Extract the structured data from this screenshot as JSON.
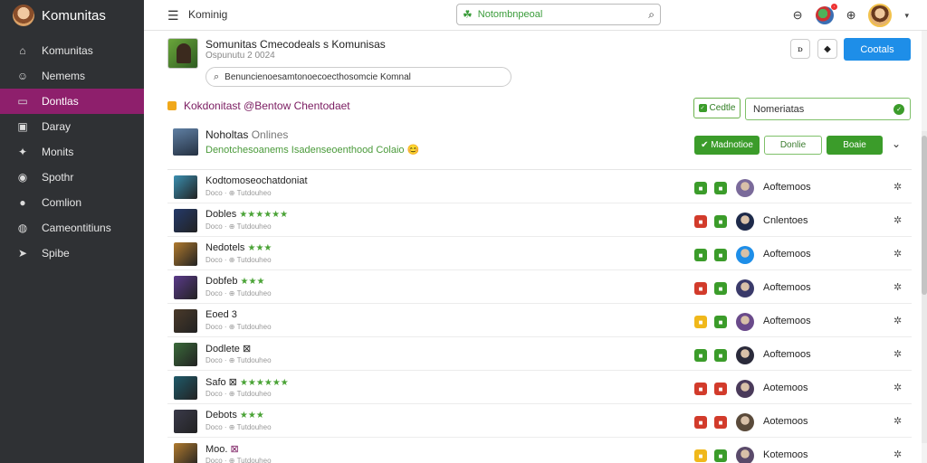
{
  "app": {
    "name": "Komunitas"
  },
  "sidebar": {
    "items": [
      {
        "label": "Komunitas",
        "icon": "home-icon",
        "glyph": "⌂",
        "active": false
      },
      {
        "label": "Nemems",
        "icon": "user-icon",
        "glyph": "☺",
        "active": false
      },
      {
        "label": "Dontlas",
        "icon": "folder-icon",
        "glyph": "▭",
        "active": true
      },
      {
        "label": "Daray",
        "icon": "grid-icon",
        "glyph": "▣",
        "active": false
      },
      {
        "label": "Monits",
        "icon": "pin-icon",
        "glyph": "✦",
        "active": false
      },
      {
        "label": "Spothr",
        "icon": "location-icon",
        "glyph": "◉",
        "active": false
      },
      {
        "label": "Comlion",
        "icon": "chat-icon",
        "glyph": "●",
        "active": false
      },
      {
        "label": "Cameontitiuns",
        "icon": "globe-icon",
        "glyph": "◍",
        "active": false
      },
      {
        "label": "Spibe",
        "icon": "send-icon",
        "glyph": "➤",
        "active": false
      }
    ]
  },
  "topbar": {
    "title": "Kominig",
    "search_value": "Notombnpeoal",
    "menu_glyph": "☰",
    "search_glyph": "⌕"
  },
  "group": {
    "title": "Somunitas Cmecodeals s Komunisas",
    "subtitle": "Ospunutu 2 0024",
    "search_value": "Benuncienoesamtonoecoecthosomcie Komnal",
    "primary_button": "Cootals",
    "icon_button_a": "ꭰ",
    "icon_button_b": "◆"
  },
  "section": {
    "title": "Kokdonitast @Bentow Chentodaet",
    "small_button": "Cedtle",
    "select_value": "Nomeriatas"
  },
  "online": {
    "name": "Noholtas",
    "status": "Onlines",
    "subtitle": "Denotchesoanems Isadenseoenthood Colaio 😊",
    "btn_a": "✔ Madnotioe",
    "btn_b": "Donlie",
    "btn_c": "Boaie",
    "chevron": "⌄"
  },
  "rows": [
    {
      "name": "Kodtomoseochatdoniat",
      "stars": "",
      "tag": "",
      "sub": "Doco · ⊕ Tutdouheo",
      "status": "Aoftemoos",
      "c1": "#3b9c2a",
      "c2": "#3b9c2a",
      "thumb": "#3a8fb0",
      "av": "#7a6a9a"
    },
    {
      "name": "Dobles",
      "stars": "★★★★★★",
      "tag": "",
      "sub": "Doco · ⊕ Tutdouheo",
      "status": "Cnlentoes",
      "c1": "#d23b2b",
      "c2": "#3b9c2a",
      "thumb": "#243a6a",
      "av": "#1e2a4a"
    },
    {
      "name": "Nedotels",
      "stars": "★★★",
      "tag": "",
      "sub": "Doco · ⊕ Tutdouheo",
      "status": "Aoftemoos",
      "c1": "#3b9c2a",
      "c2": "#3b9c2a",
      "thumb": "#b07a2e",
      "av": "#1e8ee8"
    },
    {
      "name": "Dobfeb",
      "stars": "★★★",
      "tag": "",
      "sub": "Doco · ⊕ Tutdouheo",
      "status": "Aoftemoos",
      "c1": "#d23b2b",
      "c2": "#3b9c2a",
      "thumb": "#5a3a8a",
      "av": "#3a3a6a"
    },
    {
      "name": "Eoed 3",
      "stars": "",
      "tag": "",
      "sub": "Doco · ⊕ Tutdouheo",
      "status": "Aoftemoos",
      "c1": "#f0b81b",
      "c2": "#3b9c2a",
      "thumb": "#4a3a2a",
      "av": "#6a4a8a"
    },
    {
      "name": "Dodlete ⊠",
      "stars": "",
      "tag": "",
      "sub": "Doco · ⊕ Tutdouheo",
      "status": "Aoftemoos",
      "c1": "#3b9c2a",
      "c2": "#3b9c2a",
      "thumb": "#3a6a3a",
      "av": "#2a2a3a"
    },
    {
      "name": "Safo ⊠",
      "stars": "★★★★★★",
      "tag": "",
      "sub": "Doco · ⊕ Tutdouheo",
      "status": "Aotemoos",
      "c1": "#d23b2b",
      "c2": "#d23b2b",
      "thumb": "#1f5a6a",
      "av": "#4a3a5a"
    },
    {
      "name": "Debots",
      "stars": "★★★",
      "tag": "",
      "sub": "Doco · ⊕ Tutdouheo",
      "status": "Aotemoos",
      "c1": "#d23b2b",
      "c2": "#d23b2b",
      "thumb": "#3a3a4a",
      "av": "#5a4a3a"
    },
    {
      "name": "Moo.",
      "stars": "",
      "tag": "⊠",
      "sub": "Doco · ⊕ Tutdouheo",
      "status": "Kotemoos",
      "c1": "#f0b81b",
      "c2": "#3b9c2a",
      "thumb": "#b07a2e",
      "av": "#5a4a6a"
    }
  ]
}
